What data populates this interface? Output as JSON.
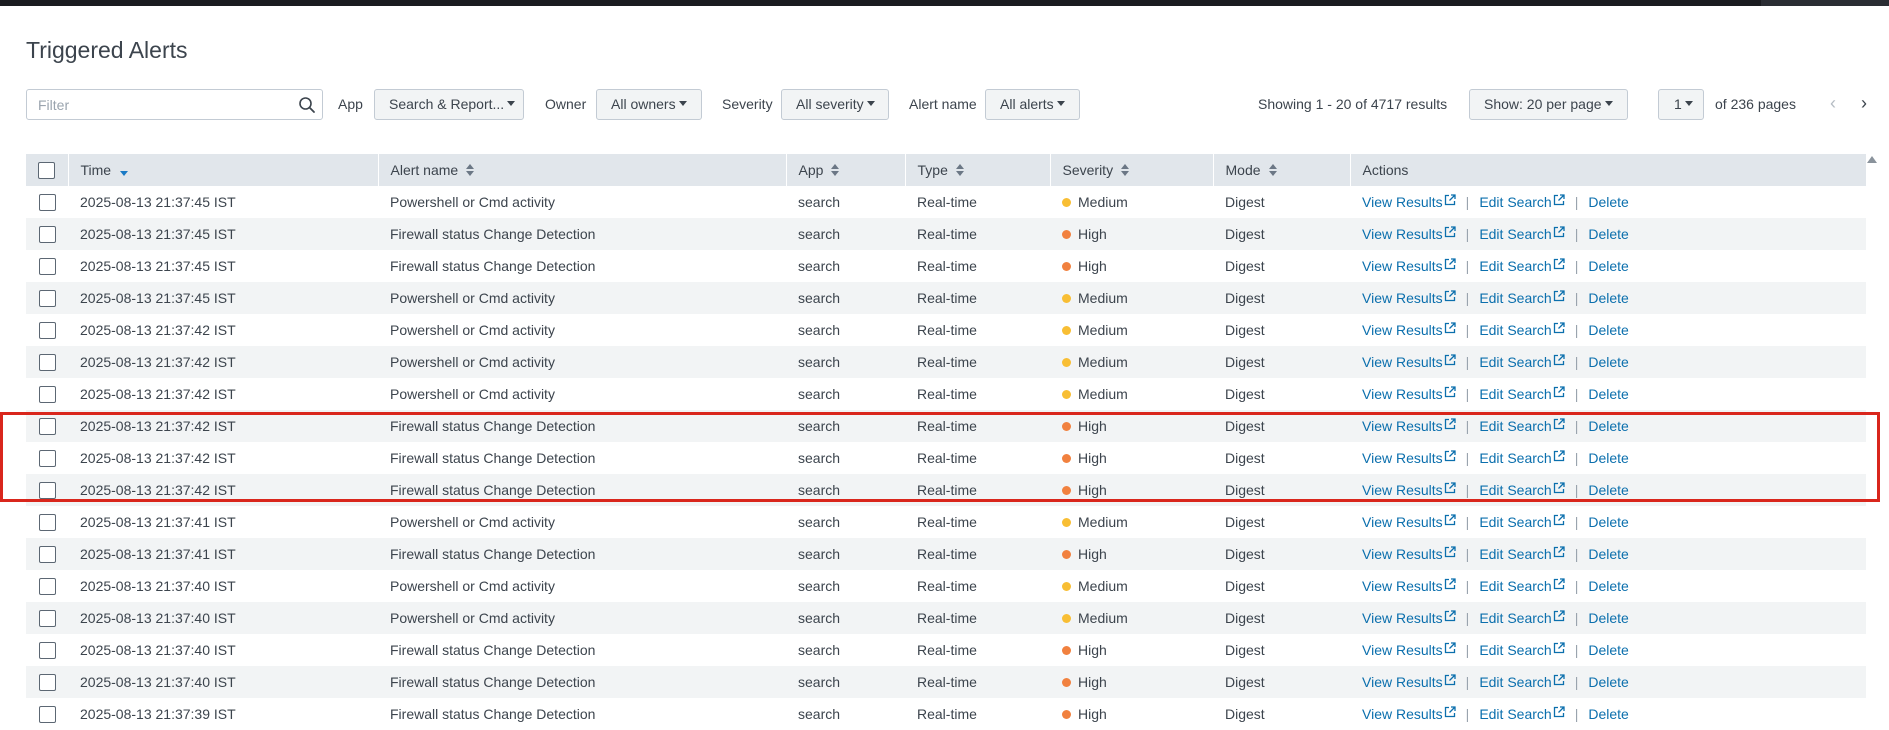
{
  "page": {
    "title": "Triggered Alerts"
  },
  "filter": {
    "placeholder": "Filter"
  },
  "filters": {
    "app_label": "App",
    "app_value": "Search & Report...",
    "owner_label": "Owner",
    "owner_value": "All owners",
    "severity_label": "Severity",
    "severity_value": "All severity",
    "alert_name_label": "Alert name",
    "alert_name_value": "All alerts"
  },
  "pagination": {
    "results_text": "Showing 1 - 20 of 4717 results",
    "per_page": "Show: 20 per page",
    "current_page": "1",
    "total_pages_text": "of 236 pages",
    "prev_icon": "‹",
    "next_icon": "›"
  },
  "table": {
    "columns": [
      "Time",
      "Alert name",
      "App",
      "Type",
      "Severity",
      "Mode",
      "Actions"
    ],
    "actions": {
      "view": "View Results",
      "edit": "Edit Search",
      "delete": "Delete",
      "separator": "|"
    },
    "severity_colors": {
      "Medium": "#f8be34",
      "High": "#f1813f"
    },
    "rows": [
      {
        "time": "2025-08-13 21:37:45 IST",
        "alert": "Powershell or Cmd activity",
        "app": "search",
        "type": "Real-time",
        "severity": "Medium",
        "mode": "Digest"
      },
      {
        "time": "2025-08-13 21:37:45 IST",
        "alert": "Firewall status Change Detection",
        "app": "search",
        "type": "Real-time",
        "severity": "High",
        "mode": "Digest"
      },
      {
        "time": "2025-08-13 21:37:45 IST",
        "alert": "Firewall status Change Detection",
        "app": "search",
        "type": "Real-time",
        "severity": "High",
        "mode": "Digest"
      },
      {
        "time": "2025-08-13 21:37:45 IST",
        "alert": "Powershell or Cmd activity",
        "app": "search",
        "type": "Real-time",
        "severity": "Medium",
        "mode": "Digest"
      },
      {
        "time": "2025-08-13 21:37:42 IST",
        "alert": "Powershell or Cmd activity",
        "app": "search",
        "type": "Real-time",
        "severity": "Medium",
        "mode": "Digest"
      },
      {
        "time": "2025-08-13 21:37:42 IST",
        "alert": "Powershell or Cmd activity",
        "app": "search",
        "type": "Real-time",
        "severity": "Medium",
        "mode": "Digest"
      },
      {
        "time": "2025-08-13 21:37:42 IST",
        "alert": "Powershell or Cmd activity",
        "app": "search",
        "type": "Real-time",
        "severity": "Medium",
        "mode": "Digest"
      },
      {
        "time": "2025-08-13 21:37:42 IST",
        "alert": "Firewall status Change Detection",
        "app": "search",
        "type": "Real-time",
        "severity": "High",
        "mode": "Digest"
      },
      {
        "time": "2025-08-13 21:37:42 IST",
        "alert": "Firewall status Change Detection",
        "app": "search",
        "type": "Real-time",
        "severity": "High",
        "mode": "Digest"
      },
      {
        "time": "2025-08-13 21:37:42 IST",
        "alert": "Firewall status Change Detection",
        "app": "search",
        "type": "Real-time",
        "severity": "High",
        "mode": "Digest"
      },
      {
        "time": "2025-08-13 21:37:41 IST",
        "alert": "Powershell or Cmd activity",
        "app": "search",
        "type": "Real-time",
        "severity": "Medium",
        "mode": "Digest"
      },
      {
        "time": "2025-08-13 21:37:41 IST",
        "alert": "Firewall status Change Detection",
        "app": "search",
        "type": "Real-time",
        "severity": "High",
        "mode": "Digest"
      },
      {
        "time": "2025-08-13 21:37:40 IST",
        "alert": "Powershell or Cmd activity",
        "app": "search",
        "type": "Real-time",
        "severity": "Medium",
        "mode": "Digest"
      },
      {
        "time": "2025-08-13 21:37:40 IST",
        "alert": "Powershell or Cmd activity",
        "app": "search",
        "type": "Real-time",
        "severity": "Medium",
        "mode": "Digest"
      },
      {
        "time": "2025-08-13 21:37:40 IST",
        "alert": "Firewall status Change Detection",
        "app": "search",
        "type": "Real-time",
        "severity": "High",
        "mode": "Digest"
      },
      {
        "time": "2025-08-13 21:37:40 IST",
        "alert": "Firewall status Change Detection",
        "app": "search",
        "type": "Real-time",
        "severity": "High",
        "mode": "Digest"
      },
      {
        "time": "2025-08-13 21:37:39 IST",
        "alert": "Firewall status Change Detection",
        "app": "search",
        "type": "Real-time",
        "severity": "High",
        "mode": "Digest"
      }
    ]
  }
}
